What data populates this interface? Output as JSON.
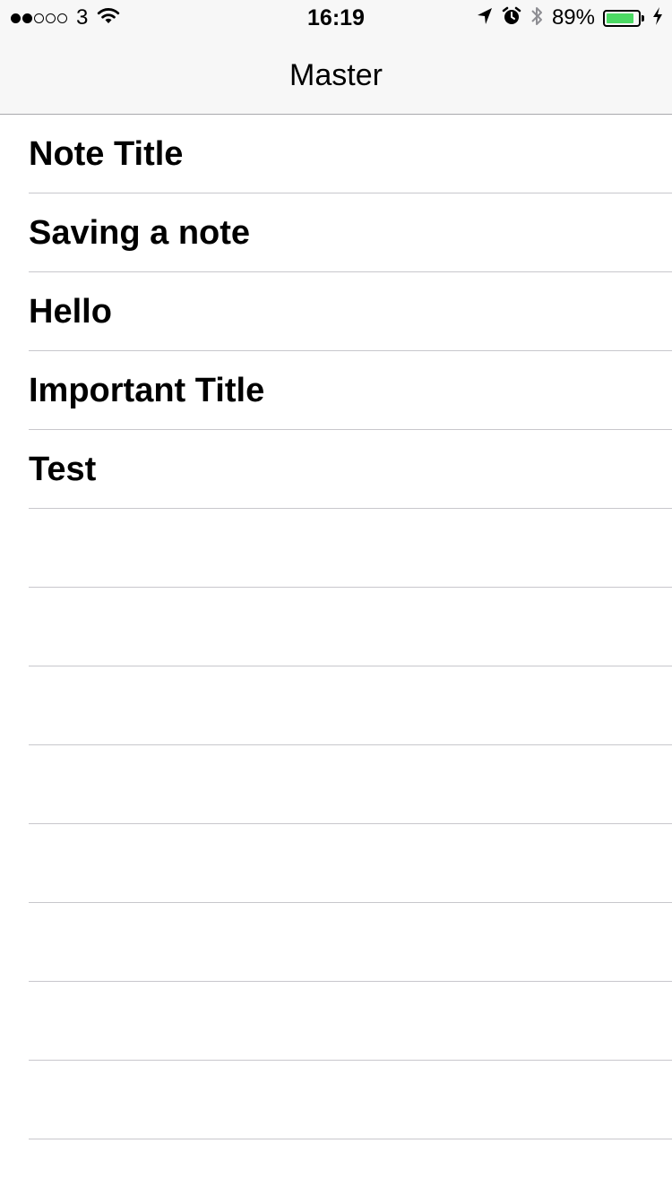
{
  "status_bar": {
    "signal_bars_filled": 2,
    "signal_bars_total": 5,
    "carrier": "3",
    "time": "16:19",
    "battery_percent_text": "89%",
    "battery_level": 0.89,
    "battery_color": "#4cd964",
    "icons": [
      "wifi-icon",
      "location-arrow-icon",
      "alarm-clock-icon",
      "bluetooth-icon",
      "charging-bolt-icon"
    ]
  },
  "nav": {
    "title": "Master"
  },
  "notes": [
    {
      "title": "Note Title"
    },
    {
      "title": "Saving a note"
    },
    {
      "title": "Hello"
    },
    {
      "title": "Important Title"
    },
    {
      "title": "Test"
    },
    {
      "title": ""
    },
    {
      "title": ""
    },
    {
      "title": ""
    },
    {
      "title": ""
    },
    {
      "title": ""
    },
    {
      "title": ""
    },
    {
      "title": ""
    },
    {
      "title": ""
    },
    {
      "title": ""
    }
  ]
}
